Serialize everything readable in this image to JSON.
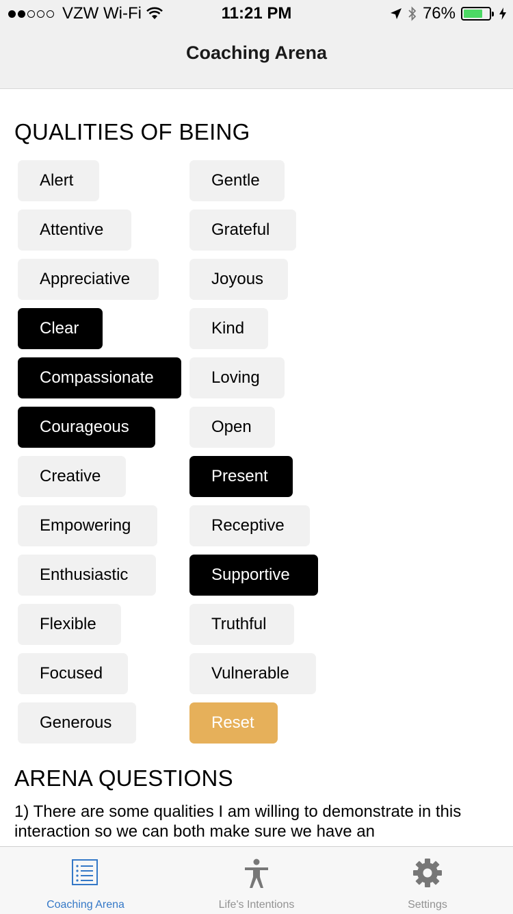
{
  "status_bar": {
    "carrier": "VZW Wi-Fi",
    "time": "11:21 PM",
    "battery": "76%",
    "signal_dots_filled": 2,
    "signal_dots_total": 5
  },
  "nav": {
    "title": "Coaching Arena"
  },
  "qualities": {
    "heading": "QUALITIES OF BEING",
    "left_column": [
      {
        "label": "Alert",
        "selected": false
      },
      {
        "label": "Attentive",
        "selected": false
      },
      {
        "label": "Appreciative",
        "selected": false
      },
      {
        "label": "Clear",
        "selected": true
      },
      {
        "label": "Compassionate",
        "selected": true
      },
      {
        "label": "Courageous",
        "selected": true
      },
      {
        "label": "Creative",
        "selected": false
      },
      {
        "label": "Empowering",
        "selected": false
      },
      {
        "label": "Enthusiastic",
        "selected": false
      },
      {
        "label": "Flexible",
        "selected": false
      },
      {
        "label": "Focused",
        "selected": false
      },
      {
        "label": "Generous",
        "selected": false
      }
    ],
    "right_column": [
      {
        "label": "Gentle",
        "selected": false
      },
      {
        "label": "Grateful",
        "selected": false
      },
      {
        "label": "Joyous",
        "selected": false
      },
      {
        "label": "Kind",
        "selected": false
      },
      {
        "label": "Loving",
        "selected": false
      },
      {
        "label": "Open",
        "selected": false
      },
      {
        "label": "Present",
        "selected": true
      },
      {
        "label": "Receptive",
        "selected": false
      },
      {
        "label": "Supportive",
        "selected": true
      },
      {
        "label": "Truthful",
        "selected": false
      },
      {
        "label": "Vulnerable",
        "selected": false
      }
    ],
    "reset_label": "Reset"
  },
  "arena": {
    "heading": "ARENA QUESTIONS",
    "question_1": "1) There are some qualities I am willing to demonstrate in this interaction so we can both make sure we have an"
  },
  "tabs": [
    {
      "label": "Coaching Arena",
      "icon": "list-icon",
      "active": true
    },
    {
      "label": "Life's Intentions",
      "icon": "person-icon",
      "active": false
    },
    {
      "label": "Settings",
      "icon": "gear-icon",
      "active": false
    }
  ],
  "colors": {
    "chip_bg": "#f1f1f1",
    "chip_selected_bg": "#000000",
    "reset_bg": "#e6b05a",
    "tab_active": "#3478c7",
    "tab_inactive": "#929292"
  }
}
